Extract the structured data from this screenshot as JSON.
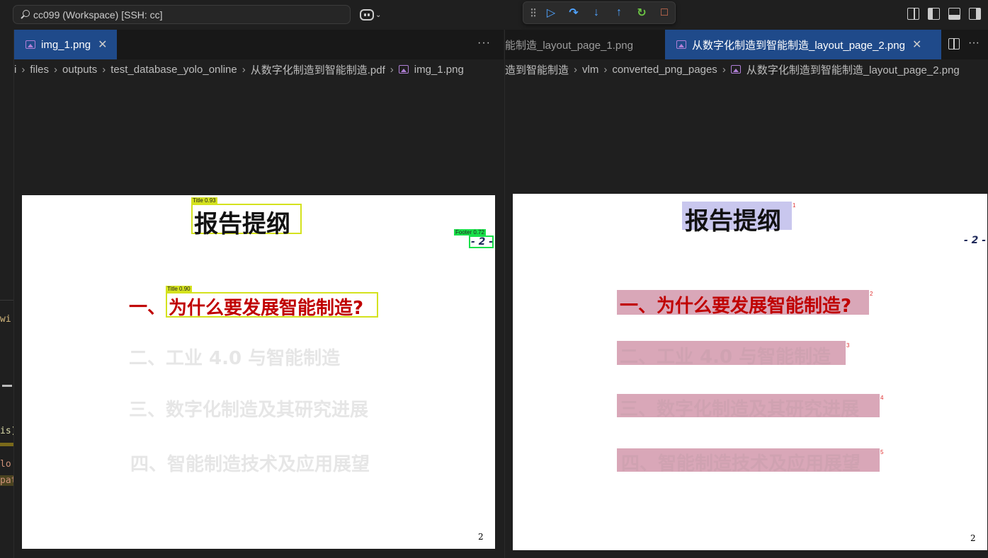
{
  "titlebar": {
    "search_text": "cc099 (Workspace) [SSH: cc]"
  },
  "debug_toolbar": {
    "icons": [
      "grip-icon",
      "continue-icon",
      "step-over-icon",
      "step-into-icon",
      "step-out-icon",
      "restart-icon",
      "stop-icon"
    ]
  },
  "codestrip": {
    "tokens": [
      "wi",
      "is)",
      "lo'",
      "pat"
    ]
  },
  "left_editor": {
    "tab_label": "img_1.png",
    "more": "···",
    "breadcrumb": [
      "i",
      "files",
      "outputs",
      "test_database_yolo_online",
      "从数字化制造到智能制造.pdf",
      "img_1.png"
    ],
    "slide": {
      "title": "报告提纲",
      "heading_prefix": "一、",
      "heading_1": "为什么要发展智能制造?",
      "heading_2": "二、工业 4.0 与智能制造",
      "heading_3": "三、数字化制造及其研究进展",
      "heading_4": "四、智能制造技术及应用展望",
      "footer": "- 2 -",
      "page_number": "2",
      "detections": [
        {
          "label": "Title 0.93",
          "color": "#d4e21e"
        },
        {
          "label": "Title 0.90",
          "color": "#d4e21e"
        },
        {
          "label": "Footer 0.72",
          "color": "#19e14a"
        }
      ]
    }
  },
  "right_editor": {
    "tab_inactive_label": "能制造_layout_page_1.png",
    "tab_active_label": "从数字化制造到智能制造_layout_page_2.png",
    "breadcrumb": [
      "造到智能制造",
      "vlm",
      "converted_png_pages",
      "从数字化制造到智能制造_layout_page_2.png"
    ],
    "slide": {
      "title": "报告提纲",
      "heading_1": "一、为什么要发展智能制造?",
      "heading_2": "二、工业 4.0 与智能制造",
      "heading_3": "三、数字化制造及其研究进展",
      "heading_4": "四、智能制造技术及应用展望",
      "footer": "- 2 -",
      "page_number": "2",
      "indices": [
        "1",
        "2",
        "3",
        "4",
        "5"
      ]
    }
  },
  "colors": {
    "accent": "#0078d4",
    "heading_red": "#c00000",
    "highlight_title": "#c9c7ee",
    "highlight_heading": "#d9a7b8"
  }
}
